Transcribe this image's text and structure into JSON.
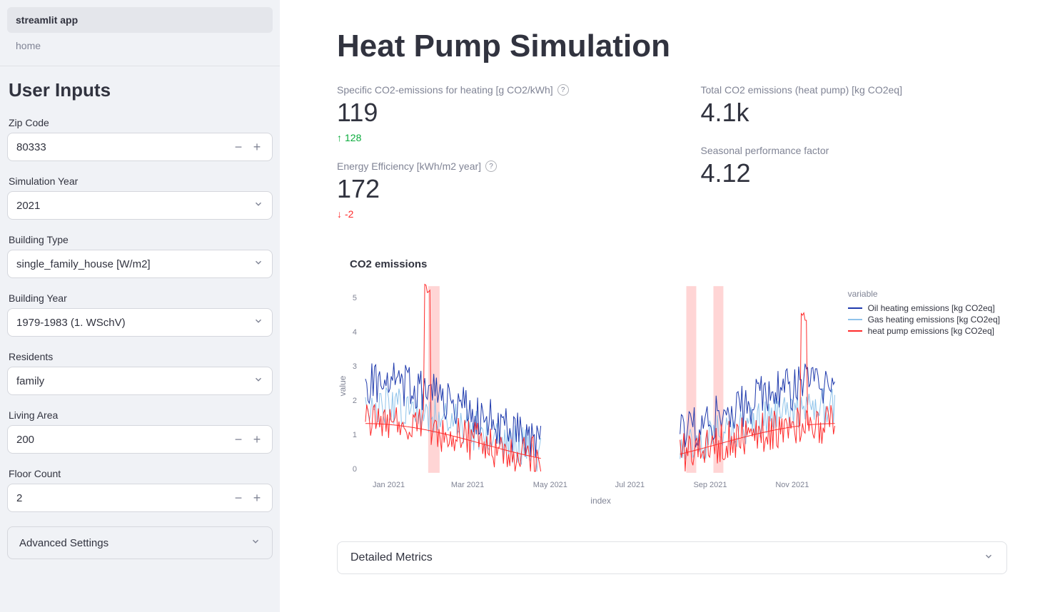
{
  "nav": {
    "items": [
      {
        "label": "streamlit app",
        "active": true
      },
      {
        "label": "home",
        "active": false
      }
    ]
  },
  "sidebar": {
    "title": "User Inputs",
    "zip_label": "Zip Code",
    "zip_value": "80333",
    "sim_year_label": "Simulation Year",
    "sim_year_value": "2021",
    "building_type_label": "Building Type",
    "building_type_value": "single_family_house [W/m2]",
    "building_year_label": "Building Year",
    "building_year_value": "1979-1983 (1. WSchV)",
    "residents_label": "Residents",
    "residents_value": "family",
    "living_area_label": "Living Area",
    "living_area_value": "200",
    "floor_count_label": "Floor Count",
    "floor_count_value": "2",
    "advanced_label": "Advanced Settings"
  },
  "main": {
    "title": "Heat Pump Simulation",
    "metrics": {
      "co2_specific": {
        "label": "Specific CO2-emissions for heating [g CO2/kWh]",
        "value": "119",
        "delta": "128",
        "dir": "up"
      },
      "energy_eff": {
        "label": "Energy Efficiency [kWh/m2 year]",
        "value": "172",
        "delta": "-2",
        "dir": "down"
      },
      "total_co2": {
        "label": "Total CO2 emissions (heat pump) [kg CO2eq]",
        "value": "4.1k"
      },
      "spf": {
        "label": "Seasonal performance factor",
        "value": "4.12"
      }
    },
    "chart_title": "CO2 emissions",
    "detailed_label": "Detailed Metrics"
  },
  "chart_data": {
    "type": "line",
    "xlabel": "index",
    "ylabel": "value",
    "ylim": [
      0,
      5.5
    ],
    "x_ticks": [
      "Jan 2021",
      "Mar 2021",
      "May 2021",
      "Jul 2021",
      "Sep 2021",
      "Nov 2021"
    ],
    "legend_title": "variable",
    "series": [
      {
        "name": "Oil heating emissions [kg CO2eq]",
        "color": "#1f3aad"
      },
      {
        "name": "Gas heating emissions [kg CO2eq]",
        "color": "#8fc3ea"
      },
      {
        "name": "heat pump emissions [kg CO2eq]",
        "color": "#ff2b2b"
      }
    ],
    "note": "high-freq daily series Jan–Dec 2021; approx ranges: oil 0.3–3.8, gas 0.2–3.0, heat-pump 0.1–5.6 (peaks Feb & Dec); summer gap ~mid-May–late-Aug"
  }
}
